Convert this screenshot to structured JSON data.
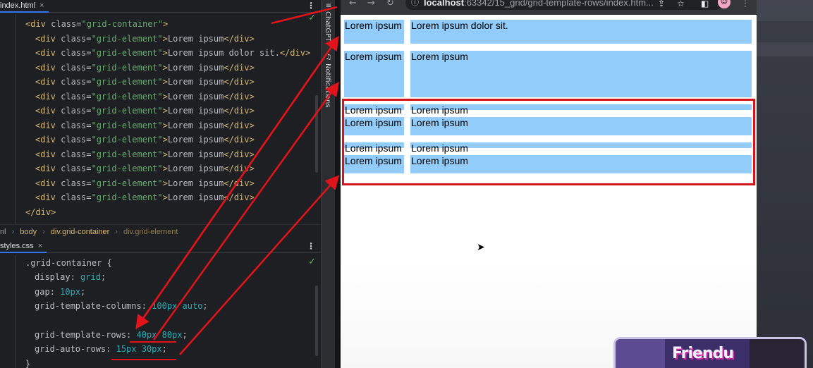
{
  "editor": {
    "html_tab": {
      "label": "index.html",
      "close": "×"
    },
    "html_code": [
      {
        "indent": 0,
        "open": "<div",
        "attr": " class=",
        "val": "\"grid-container\"",
        "close": ">",
        "text": "",
        "end": ""
      },
      {
        "indent": 1,
        "open": "<div",
        "attr": " class=",
        "val": "\"grid-element\"",
        "close": ">",
        "text": "Lorem ipsum",
        "end": "</div>"
      },
      {
        "indent": 1,
        "open": "<div",
        "attr": " class=",
        "val": "\"grid-element\"",
        "close": ">",
        "text": "Lorem ipsum dolor sit.",
        "end": "</div>"
      },
      {
        "indent": 1,
        "open": "<div",
        "attr": " class=",
        "val": "\"grid-element\"",
        "close": ">",
        "text": "Lorem ipsum",
        "end": "</div>"
      },
      {
        "indent": 1,
        "open": "<div",
        "attr": " class=",
        "val": "\"grid-element\"",
        "close": ">",
        "text": "Lorem ipsum",
        "end": "</div>"
      },
      {
        "indent": 1,
        "open": "<div",
        "attr": " class=",
        "val": "\"grid-element\"",
        "close": ">",
        "text": "Lorem ipsum",
        "end": "</div>"
      },
      {
        "indent": 1,
        "open": "<div",
        "attr": " class=",
        "val": "\"grid-element\"",
        "close": ">",
        "text": "Lorem ipsum",
        "end": "</div>"
      },
      {
        "indent": 1,
        "open": "<div",
        "attr": " class=",
        "val": "\"grid-element\"",
        "close": ">",
        "text": "Lorem ipsum",
        "end": "</div>"
      },
      {
        "indent": 1,
        "open": "<div",
        "attr": " class=",
        "val": "\"grid-element\"",
        "close": ">",
        "text": "Lorem ipsum",
        "end": "</div>"
      },
      {
        "indent": 1,
        "open": "<div",
        "attr": " class=",
        "val": "\"grid-element\"",
        "close": ">",
        "text": "Lorem ipsum",
        "end": "</div>"
      },
      {
        "indent": 1,
        "open": "<div",
        "attr": " class=",
        "val": "\"grid-element\"",
        "close": ">",
        "text": "Lorem ipsum",
        "end": "</div>"
      },
      {
        "indent": 1,
        "open": "<div",
        "attr": " class=",
        "val": "\"grid-element\"",
        "close": ">",
        "text": "Lorem ipsum",
        "end": "</div>"
      },
      {
        "indent": 1,
        "open": "<div",
        "attr": " class=",
        "val": "\"grid-element\"",
        "close": ">",
        "text": "Lorem ipsum",
        "end": "</div>"
      },
      {
        "indent": 0,
        "open": "</div",
        "attr": "",
        "val": "",
        "close": ">",
        "text": "",
        "end": ""
      }
    ],
    "breadcrumb": {
      "first": "nl",
      "body": "body",
      "container": "div.grid-container",
      "element": "div.grid-element"
    },
    "css_tab": {
      "label": "styles.css",
      "close": "×"
    },
    "css_code": [
      {
        "indent": 0,
        "selector": ".grid-container",
        "prop": "",
        "value": "",
        "brace": " {"
      },
      {
        "indent": 1,
        "selector": "",
        "prop": "display",
        "value": "grid",
        "brace": ""
      },
      {
        "indent": 1,
        "selector": "",
        "prop": "gap",
        "value": "10px",
        "brace": ""
      },
      {
        "indent": 1,
        "selector": "",
        "prop": "grid-template-columns",
        "value": "100px auto",
        "brace": ""
      },
      {
        "indent": 1,
        "selector": "",
        "prop": "",
        "value": "",
        "brace": ""
      },
      {
        "indent": 1,
        "selector": "",
        "prop": "grid-template-rows",
        "value": "40px 80px",
        "brace": ""
      },
      {
        "indent": 1,
        "selector": "",
        "prop": "grid-auto-rows",
        "value": "15px 30px",
        "brace": ""
      },
      {
        "indent": 0,
        "selector": "}",
        "prop": "",
        "value": "",
        "brace": ""
      }
    ],
    "side_labels": {
      "chatgpt": "ChatGPT",
      "notifications": "Notifications"
    }
  },
  "browser": {
    "url_host": "localhost",
    "url_path": ":63342/15_grid/grid-template-rows/index.htm...",
    "grid_items": [
      "Lorem ipsum",
      "Lorem ipsum dolor sit.",
      "Lorem ipsum",
      "Lorem ipsum",
      "Lorem ipsum",
      "Lorem ipsum",
      "Lorem ipsum",
      "Lorem ipsum",
      "Lorem ipsum",
      "Lorem ipsum",
      "Lorem ipsum",
      "Lorem ipsum"
    ]
  },
  "webcam": {
    "brand_text": "Friendu"
  },
  "colors": {
    "accent_red": "#e3131b",
    "grid_item_bg": "#91ccfb",
    "editor_bg": "#1e1f22"
  }
}
